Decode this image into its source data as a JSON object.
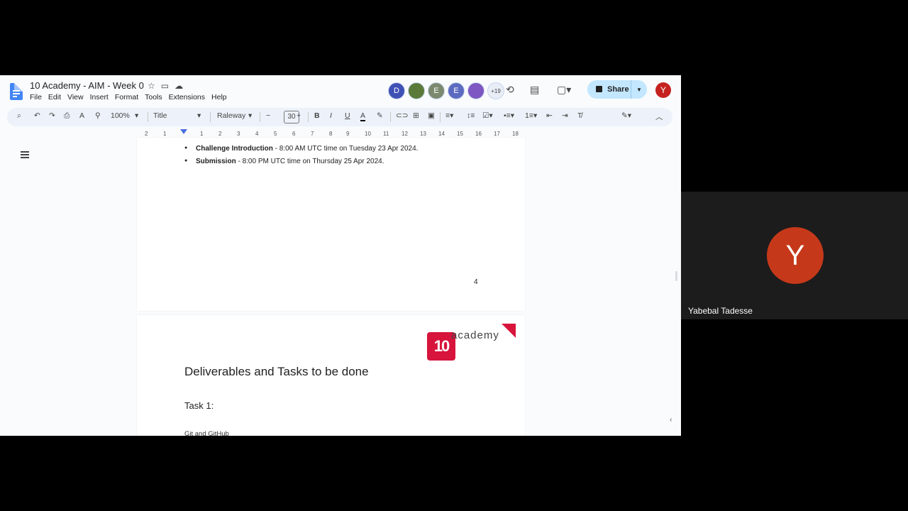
{
  "doc": {
    "title": "10 Academy - AIM - Week 0",
    "menu": [
      "File",
      "Edit",
      "View",
      "Insert",
      "Format",
      "Tools",
      "Extensions",
      "Help"
    ],
    "collaborators": [
      {
        "initial": "D",
        "color": "#3f51b5"
      },
      {
        "initial": "",
        "color": "#5a7a3a"
      },
      {
        "initial": "E",
        "color": "#7b8a6e"
      },
      {
        "initial": "E",
        "color": "#5c6bc0"
      },
      {
        "initial": "",
        "color": "#7e57c2"
      }
    ],
    "more_collaborators": "+19",
    "share_label": "Share",
    "profile_initial": "Y"
  },
  "toolbar": {
    "zoom": "100%",
    "style": "Title",
    "font": "Raleway",
    "font_size": "30"
  },
  "ruler": {
    "ticks": [
      "2",
      "1",
      "1",
      "2",
      "3",
      "4",
      "5",
      "6",
      "7",
      "8",
      "9",
      "10",
      "11",
      "12",
      "13",
      "14",
      "15",
      "16",
      "17",
      "18"
    ]
  },
  "page1": {
    "bullets": [
      {
        "bold": "Challenge Introduction",
        "rest": " - 8:00 AM UTC time on Tuesday 23 Apr 2024."
      },
      {
        "bold": "Submission",
        "rest": " - 8:00 PM UTC time on Thursday 25 Apr 2024."
      }
    ],
    "page_number": "4"
  },
  "page2": {
    "logo_number": "10",
    "logo_text": "academy",
    "heading": "Deliverables and Tasks to be done",
    "subheading": "Task 1:",
    "text": "Git and GitHub"
  },
  "participant": {
    "initial": "Y",
    "name": "Yabebal Tadesse"
  }
}
